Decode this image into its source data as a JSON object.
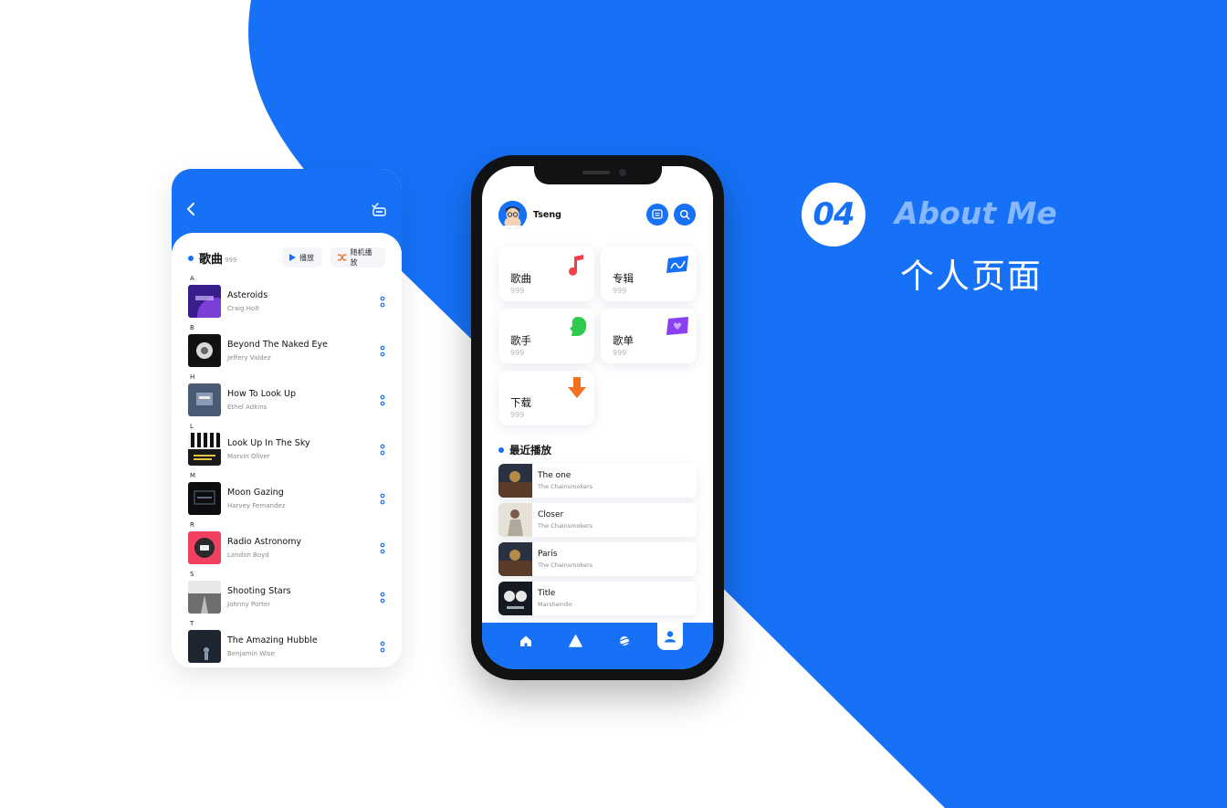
{
  "colors": {
    "primary": "#1671f7",
    "accent_light": "#87b8ff",
    "background": "#ffffff"
  },
  "heading": {
    "number": "04",
    "title_en": "About Me",
    "title_zh": "个人页面"
  },
  "songs_page": {
    "back_icon": "chevron-left-icon",
    "edit_icon": "checklist-edit-icon",
    "title": "歌曲",
    "count": "999",
    "play_label": "播放",
    "shuffle_label": "随机播放",
    "groups": [
      {
        "letter": "A",
        "name": "Asteroids",
        "artist": "Craig Holt"
      },
      {
        "letter": "B",
        "name": "Beyond The Naked Eye",
        "artist": "Jeffery Valdez"
      },
      {
        "letter": "H",
        "name": "How To Look Up",
        "artist": "Ethel Adkins"
      },
      {
        "letter": "L",
        "name": "Look Up In The Sky",
        "artist": "Marvin Oliver"
      },
      {
        "letter": "M",
        "name": "Moon Gazing",
        "artist": "Harvey Fernandez"
      },
      {
        "letter": "R",
        "name": "Radio Astronomy",
        "artist": "Landon Boyd"
      },
      {
        "letter": "S",
        "name": "Shooting Stars",
        "artist": "Johnny Porter"
      },
      {
        "letter": "T",
        "name": "The Amazing Hubble",
        "artist": "Benjamin Wise"
      }
    ]
  },
  "profile_page": {
    "user_name": "Tseng",
    "categories": [
      {
        "label": "歌曲",
        "count": "999",
        "icon": "music-note-icon"
      },
      {
        "label": "专辑",
        "count": "999",
        "icon": "album-card-icon"
      },
      {
        "label": "歌手",
        "count": "999",
        "icon": "singer-head-icon"
      },
      {
        "label": "歌单",
        "count": "999",
        "icon": "playlist-heart-icon"
      },
      {
        "label": "下载",
        "count": "999",
        "icon": "download-arrow-icon"
      }
    ],
    "recent_title": "最近播放",
    "recent": [
      {
        "name": "The one",
        "artist": "The Chainsmokers"
      },
      {
        "name": "Closer",
        "artist": "The Chainsmokers"
      },
      {
        "name": "Paris",
        "artist": "The Chainsmokers"
      },
      {
        "name": "Title",
        "artist": "Marshemllo"
      }
    ],
    "tabs": [
      "home-icon",
      "discover-icon",
      "planet-icon",
      "profile-icon"
    ],
    "active_tab": "profile-icon"
  }
}
